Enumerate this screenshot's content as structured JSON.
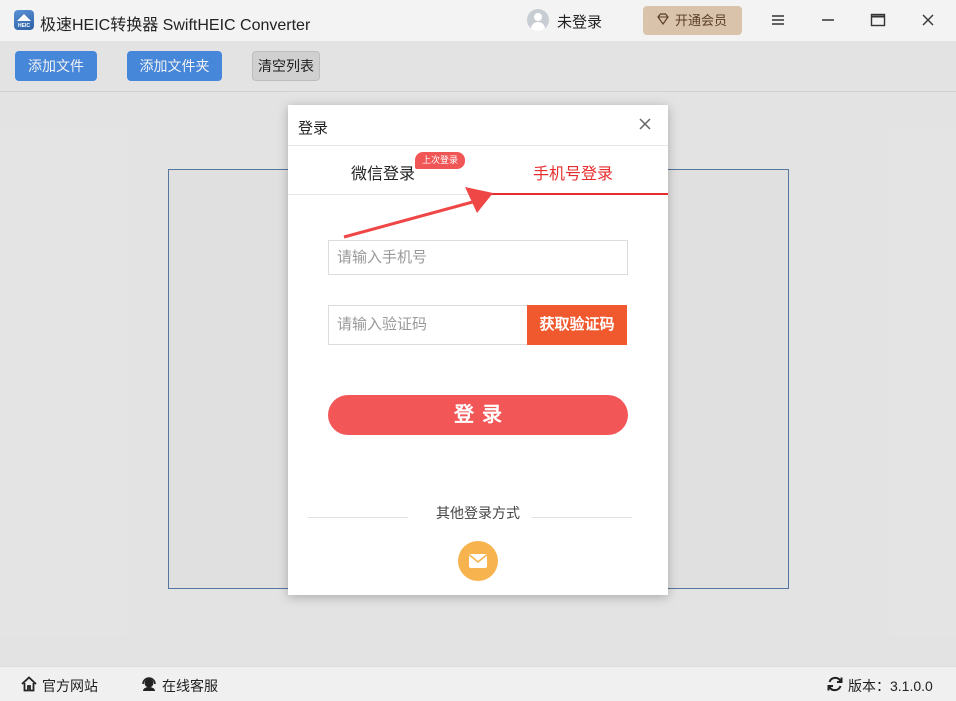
{
  "window": {
    "title": "极速HEIC转换器 SwiftHEIC Converter",
    "logo_text": "HEIC",
    "user_status": "未登录",
    "vip_button": "开通会员"
  },
  "toolbar": {
    "add_file": "添加文件",
    "add_folder": "添加文件夹",
    "clear_list": "清空列表"
  },
  "statusbar": {
    "website": "官方网站",
    "service": "在线客服",
    "version": "版本：3.1.0.0"
  },
  "login_dialog": {
    "title": "登录",
    "tabs": [
      {
        "label": "微信登录",
        "active": false
      },
      {
        "label": "手机号登录",
        "active": true
      }
    ],
    "last_login_badge": "上次登录",
    "phone_placeholder": "请输入手机号",
    "code_placeholder": "请输入验证码",
    "get_code_button": "获取验证码",
    "login_button": "登录",
    "other_methods_label": "其他登录方式"
  },
  "colors": {
    "primary_blue": "#4a8fe6",
    "accent_red": "#e62d2d",
    "login_button": "#f25656",
    "code_button": "#f0582d",
    "vip_button": "#d9c3ab",
    "mail_button": "#f7b34d"
  },
  "icons": [
    "app-logo-icon",
    "user-avatar-icon",
    "diamond-icon",
    "menu-icon",
    "minimize-icon",
    "maximize-icon",
    "close-icon",
    "home-icon",
    "headset-icon",
    "refresh-icon",
    "mail-icon",
    "arrow-annotation"
  ]
}
